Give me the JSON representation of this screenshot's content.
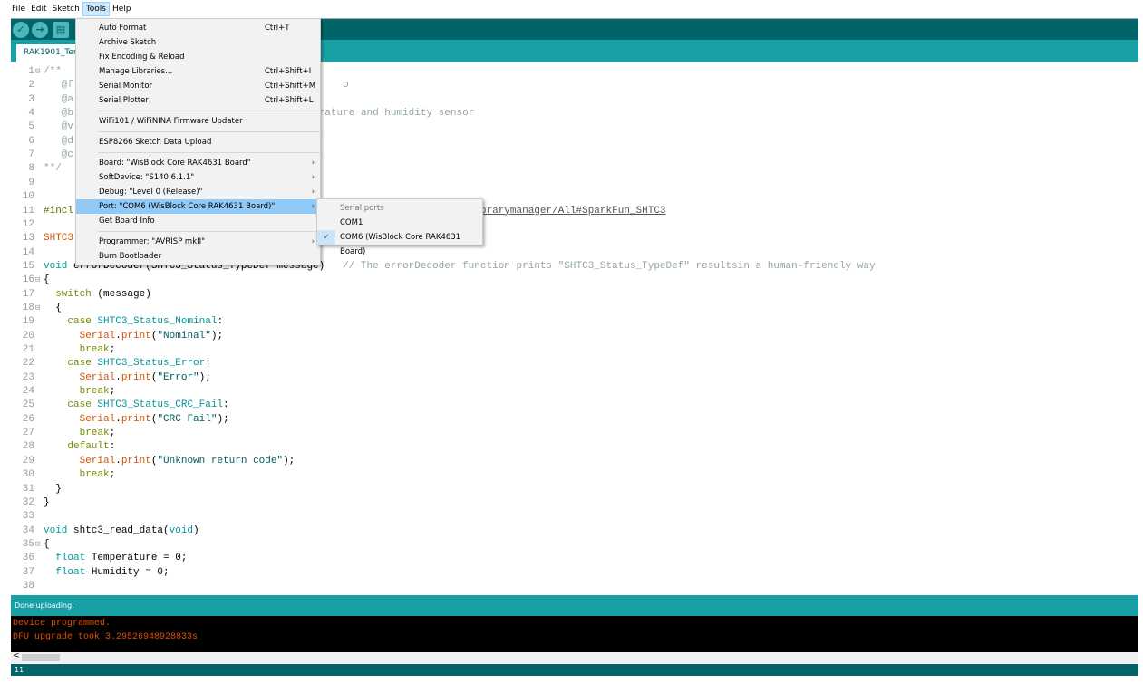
{
  "menubar": [
    "File",
    "Edit",
    "Sketch",
    "Tools",
    "Help"
  ],
  "tab": {
    "label": "RAK1901_Ten"
  },
  "tools_menu": {
    "items": [
      {
        "label": "Auto Format",
        "shortcut": "Ctrl+T"
      },
      {
        "label": "Archive Sketch"
      },
      {
        "label": "Fix Encoding & Reload"
      },
      {
        "label": "Manage Libraries...",
        "shortcut": "Ctrl+Shift+I"
      },
      {
        "label": "Serial Monitor",
        "shortcut": "Ctrl+Shift+M"
      },
      {
        "label": "Serial Plotter",
        "shortcut": "Ctrl+Shift+L",
        "sep_after": true
      },
      {
        "label": "WiFi101 / WiFiNINA Firmware Updater",
        "sep_after": true
      },
      {
        "label": "ESP8266 Sketch Data Upload",
        "sep_after": true
      },
      {
        "label": "Board: \"WisBlock Core RAK4631 Board\"",
        "submenu": true
      },
      {
        "label": "SoftDevice: \"S140  6.1.1\"",
        "submenu": true
      },
      {
        "label": "Debug: \"Level 0 (Release)\"",
        "submenu": true
      },
      {
        "label": "Port: \"COM6 (WisBlock Core RAK4631 Board)\"",
        "submenu": true,
        "highlighted": true
      },
      {
        "label": "Get Board Info",
        "sep_after": true
      },
      {
        "label": "Programmer: \"AVRISP mkII\"",
        "submenu": true
      },
      {
        "label": "Burn Bootloader"
      }
    ]
  },
  "port_submenu": {
    "header": "Serial ports",
    "items": [
      {
        "label": "COM1",
        "checked": false
      },
      {
        "label": "COM6 (WisBlock Core RAK4631 Board)",
        "checked": true
      }
    ]
  },
  "code_lines": [
    [
      [
        "/**",
        "cm"
      ]
    ],
    [
      [
        "   @f",
        "cm"
      ],
      [
        "                                             o",
        "cm"
      ]
    ],
    [
      [
        "   @a",
        "cm"
      ]
    ],
    [
      [
        "   @b",
        "cm"
      ],
      [
        "                                      mperature and humidity sensor",
        "cm"
      ]
    ],
    [
      [
        "   @v",
        "cm"
      ]
    ],
    [
      [
        "   @d",
        "cm"
      ]
    ],
    [
      [
        "   @c",
        "cm"
      ]
    ],
    [
      [
        "**/",
        "cm"
      ]
    ],
    [],
    [],
    [
      [
        "#incl",
        "inc"
      ],
      [
        "                                                                    ",
        ""
      ],
      [
        "brarymanager/All#SparkFun_SHTC3",
        "lnk"
      ]
    ],
    [],
    [
      [
        "SHTC3",
        "cl"
      ]
    ],
    [],
    [
      [
        "void",
        "kw"
      ],
      [
        " errorDecoder(SHTC3_Status_TypeDef message)   ",
        ""
      ],
      [
        "// The errorDecoder function prints \"SHTC3_Status_TypeDef\" resultsin a human-friendly way",
        "cm"
      ]
    ],
    [
      [
        "{",
        ""
      ]
    ],
    [
      [
        "  ",
        ""
      ],
      [
        "switch",
        "kw2"
      ],
      [
        " (message)",
        ""
      ]
    ],
    [
      [
        "  {",
        ""
      ]
    ],
    [
      [
        "    ",
        ""
      ],
      [
        "case",
        "kw2"
      ],
      [
        " ",
        ""
      ],
      [
        "SHTC3_Status_Nominal",
        "kw"
      ],
      [
        ":",
        ""
      ]
    ],
    [
      [
        "      ",
        ""
      ],
      [
        "Serial",
        "or"
      ],
      [
        ".",
        ""
      ],
      [
        "print",
        "or"
      ],
      [
        "(",
        ""
      ],
      [
        "\"Nominal\"",
        "st"
      ],
      [
        ");",
        ""
      ]
    ],
    [
      [
        "      ",
        ""
      ],
      [
        "break",
        "kw2"
      ],
      [
        ";",
        ""
      ]
    ],
    [
      [
        "    ",
        ""
      ],
      [
        "case",
        "kw2"
      ],
      [
        " ",
        ""
      ],
      [
        "SHTC3_Status_Error",
        "kw"
      ],
      [
        ":",
        ""
      ]
    ],
    [
      [
        "      ",
        ""
      ],
      [
        "Serial",
        "or"
      ],
      [
        ".",
        ""
      ],
      [
        "print",
        "or"
      ],
      [
        "(",
        ""
      ],
      [
        "\"Error\"",
        "st"
      ],
      [
        ");",
        ""
      ]
    ],
    [
      [
        "      ",
        ""
      ],
      [
        "break",
        "kw2"
      ],
      [
        ";",
        ""
      ]
    ],
    [
      [
        "    ",
        ""
      ],
      [
        "case",
        "kw2"
      ],
      [
        " ",
        ""
      ],
      [
        "SHTC3_Status_CRC_Fail",
        "kw"
      ],
      [
        ":",
        ""
      ]
    ],
    [
      [
        "      ",
        ""
      ],
      [
        "Serial",
        "or"
      ],
      [
        ".",
        ""
      ],
      [
        "print",
        "or"
      ],
      [
        "(",
        ""
      ],
      [
        "\"CRC Fail\"",
        "st"
      ],
      [
        ");",
        ""
      ]
    ],
    [
      [
        "      ",
        ""
      ],
      [
        "break",
        "kw2"
      ],
      [
        ";",
        ""
      ]
    ],
    [
      [
        "    ",
        ""
      ],
      [
        "default",
        "kw2"
      ],
      [
        ":",
        ""
      ]
    ],
    [
      [
        "      ",
        ""
      ],
      [
        "Serial",
        "or"
      ],
      [
        ".",
        ""
      ],
      [
        "print",
        "or"
      ],
      [
        "(",
        ""
      ],
      [
        "\"Unknown return code\"",
        "st"
      ],
      [
        ");",
        ""
      ]
    ],
    [
      [
        "      ",
        ""
      ],
      [
        "break",
        "kw2"
      ],
      [
        ";",
        ""
      ]
    ],
    [
      [
        "  }",
        ""
      ]
    ],
    [
      [
        "}",
        ""
      ]
    ],
    [],
    [
      [
        "void",
        "kw"
      ],
      [
        " shtc3_read_data(",
        ""
      ],
      [
        "void",
        "kw"
      ],
      [
        ")",
        ""
      ]
    ],
    [
      [
        "{",
        ""
      ]
    ],
    [
      [
        "  ",
        ""
      ],
      [
        "float",
        "kw"
      ],
      [
        " Temperature = 0;",
        ""
      ]
    ],
    [
      [
        "  ",
        ""
      ],
      [
        "float",
        "kw"
      ],
      [
        " Humidity = 0;",
        ""
      ]
    ],
    []
  ],
  "fold_lines": [
    1,
    16,
    18,
    35
  ],
  "status": "Done uploading.",
  "console": [
    "Device programmed.",
    "DFU upgrade took 3.29526948928833s"
  ],
  "bottom": {
    "line": "11"
  },
  "colors": {
    "toolbar": "#006468",
    "tabrow": "#17a1a5",
    "console_text": "#e34c00"
  }
}
